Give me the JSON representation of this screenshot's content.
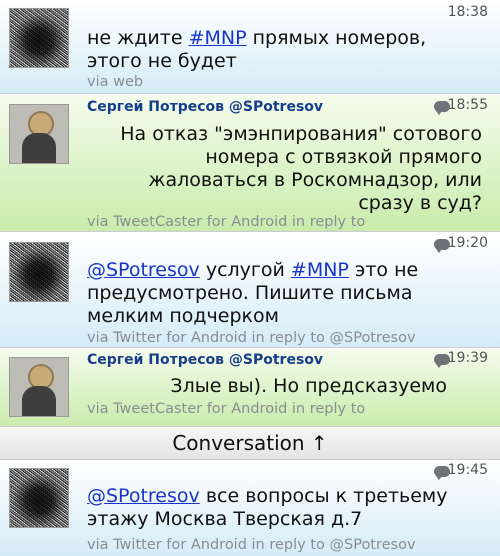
{
  "tweets": [
    {
      "time": "18:38",
      "author": "",
      "handle": "",
      "text_parts": [
        "не ждите ",
        "#MNP",
        " прямых номеров, этого не будет"
      ],
      "via": "via web"
    },
    {
      "time": "18:55",
      "author": "Сергей Потресов",
      "handle": "@SPotresov",
      "text": "На отказ \"эмэнпирования\" сотового номера с отвязкой прямого жаловаться в Роскомнадзор, или сразу в суд?",
      "via": "via TweetCaster for Android in reply to"
    },
    {
      "time": "19:20",
      "author": "",
      "handle": "",
      "text_parts": [
        "@SPotresov",
        " услугой ",
        "#MNP",
        " это не предусмотрено. Пишите письма мелким подчерком"
      ],
      "via": "via Twitter for Android in reply to @SPotresov"
    },
    {
      "time": "19:39",
      "author": "Сергей Потресов",
      "handle": "@SPotresov",
      "text": "Злые вы). Но предсказуемо",
      "via": "via TweetCaster for Android in reply to"
    },
    {
      "time": "19:45",
      "author": "",
      "handle": "",
      "text_parts": [
        "@SPotresov",
        " все вопросы к третьему этажу Москва Тверская д.7"
      ],
      "via": "via Twitter for Android in reply to @SPotresov"
    }
  ],
  "conversation_label": "Conversation ↑",
  "icons": {
    "reply_bubble": "speech-bubble-icon",
    "conversation_arrow": "arrow-up-icon"
  },
  "colors": {
    "link": "#1a34c8",
    "author": "#163e8c",
    "self_bg": "#d5ecf7",
    "other_bg": "#c9ecac"
  }
}
